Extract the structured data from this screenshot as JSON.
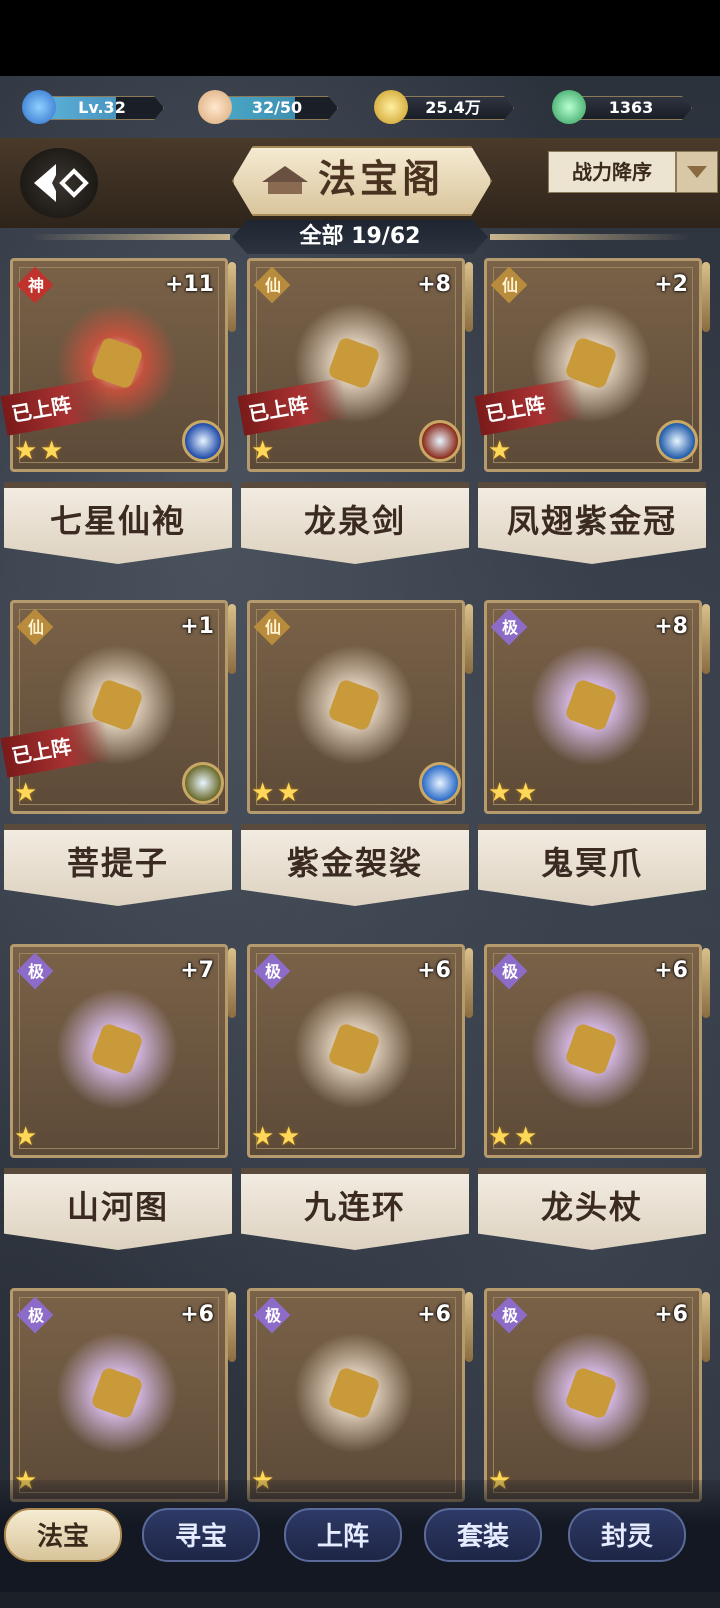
{
  "resources": {
    "level": "Lv.32",
    "energy": "32/50",
    "coins": "25.4万",
    "gems": "1363"
  },
  "header": {
    "title": "法宝阁",
    "sort_label": "战力降序",
    "count_label": "全部 19/62"
  },
  "items": [
    {
      "name": "七星仙袍",
      "grade": "神",
      "level": "+11",
      "deployed": "已上阵",
      "stars": 2
    },
    {
      "name": "龙泉剑",
      "grade": "仙",
      "level": "+8",
      "deployed": "已上阵",
      "stars": 1
    },
    {
      "name": "凤翅紫金冠",
      "grade": "仙",
      "level": "+2",
      "deployed": "已上阵",
      "stars": 1
    },
    {
      "name": "菩提子",
      "grade": "仙",
      "level": "+1",
      "deployed": "已上阵",
      "stars": 1
    },
    {
      "name": "紫金袈裟",
      "grade": "仙",
      "level": "",
      "deployed": "",
      "stars": 2
    },
    {
      "name": "鬼冥爪",
      "grade": "极",
      "level": "+8",
      "deployed": "",
      "stars": 2
    },
    {
      "name": "山河图",
      "grade": "极",
      "level": "+7",
      "deployed": "",
      "stars": 1
    },
    {
      "name": "九连环",
      "grade": "极",
      "level": "+6",
      "deployed": "",
      "stars": 2
    },
    {
      "name": "龙头杖",
      "grade": "极",
      "level": "+6",
      "deployed": "",
      "stars": 2
    },
    {
      "name": "",
      "grade": "极",
      "level": "+6",
      "deployed": "",
      "stars": 1
    },
    {
      "name": "",
      "grade": "极",
      "level": "+6",
      "deployed": "",
      "stars": 1
    },
    {
      "name": "",
      "grade": "极",
      "level": "+6",
      "deployed": "",
      "stars": 1
    }
  ],
  "tabs": [
    "法宝",
    "寻宝",
    "上阵",
    "套装",
    "封灵"
  ],
  "colors": {
    "grade_shen": "#c0322c",
    "grade_xian": "#b88c3c",
    "grade_ji": "#8c6cc8",
    "star": "#ffd85a"
  }
}
